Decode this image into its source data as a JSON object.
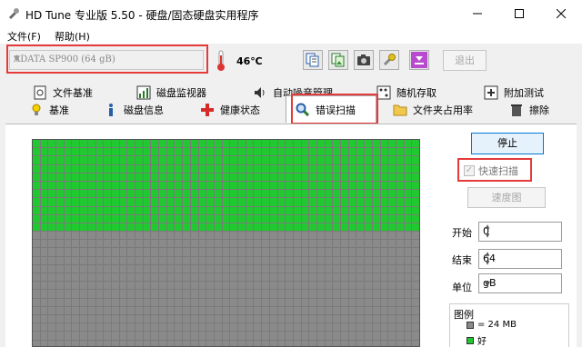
{
  "window": {
    "title": "HD Tune 专业版 5.50 - 硬盘/固态硬盘实用程序"
  },
  "menu": {
    "file": "文件(F)",
    "help": "帮助(H)"
  },
  "toolbar": {
    "drive": "ADATA SP900 (64 gB)",
    "temperature": "46℃",
    "exit_label": "退出",
    "buttons": [
      "copy-text-icon",
      "copy-image-icon",
      "screenshot-icon",
      "options-icon",
      "save-icon"
    ]
  },
  "tabs_row1": [
    {
      "label": "文件基准",
      "icon": "file-benchmark-icon"
    },
    {
      "label": "磁盘监视器",
      "icon": "disk-monitor-icon"
    },
    {
      "label": "自动噪音管理",
      "icon": "speaker-icon"
    },
    {
      "label": "随机存取",
      "icon": "random-access-icon"
    },
    {
      "label": "附加测试",
      "icon": "extra-tests-icon"
    }
  ],
  "tabs_row2": [
    {
      "label": "基准",
      "icon": "benchmark-icon"
    },
    {
      "label": "磁盘信息",
      "icon": "info-icon"
    },
    {
      "label": "健康状态",
      "icon": "health-icon"
    },
    {
      "label": "错误扫描",
      "icon": "magnifier-icon"
    },
    {
      "label": "文件夹占用率",
      "icon": "folder-icon"
    },
    {
      "label": "擦除",
      "icon": "trash-icon"
    }
  ],
  "active_tab": "错误扫描",
  "scan": {
    "stop_label": "停止",
    "quick_scan_label": "快速扫描",
    "quick_scan_checked": true,
    "speed_map_label": "速度图",
    "start_label": "开始",
    "start_value": "0",
    "end_label": "结束",
    "end_value": "64",
    "unit_label": "单位",
    "unit_value": "gB"
  },
  "legend": {
    "title": "图例",
    "block_size": "= 24 MB",
    "good": "好"
  },
  "colors": {
    "good": "#1fc92f",
    "pending": "#8a8a8a",
    "highlight": "#e53a3a",
    "accent": "#0078d7"
  }
}
